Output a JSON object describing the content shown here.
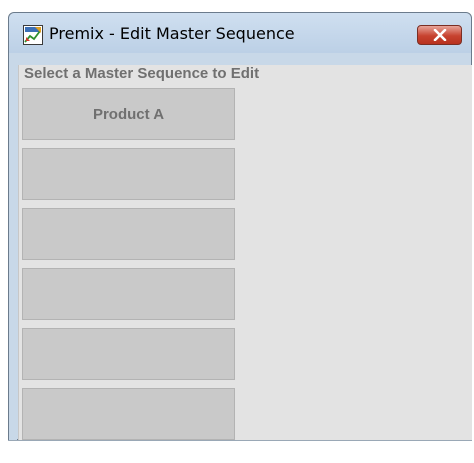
{
  "window": {
    "title": "Premix - Edit Master Sequence",
    "close_label": "Close"
  },
  "main": {
    "prompt": "Select a Master Sequence to Edit",
    "sequences": [
      {
        "label": "Product A"
      },
      {
        "label": ""
      },
      {
        "label": ""
      },
      {
        "label": ""
      },
      {
        "label": ""
      },
      {
        "label": ""
      }
    ]
  },
  "icons": {
    "app": "premix-app-icon",
    "close": "close-icon"
  },
  "colors": {
    "client_background": "#e3e3e3",
    "button_face": "#c9c9c9",
    "text_gray": "#707070",
    "close_red": "#c7422f"
  }
}
